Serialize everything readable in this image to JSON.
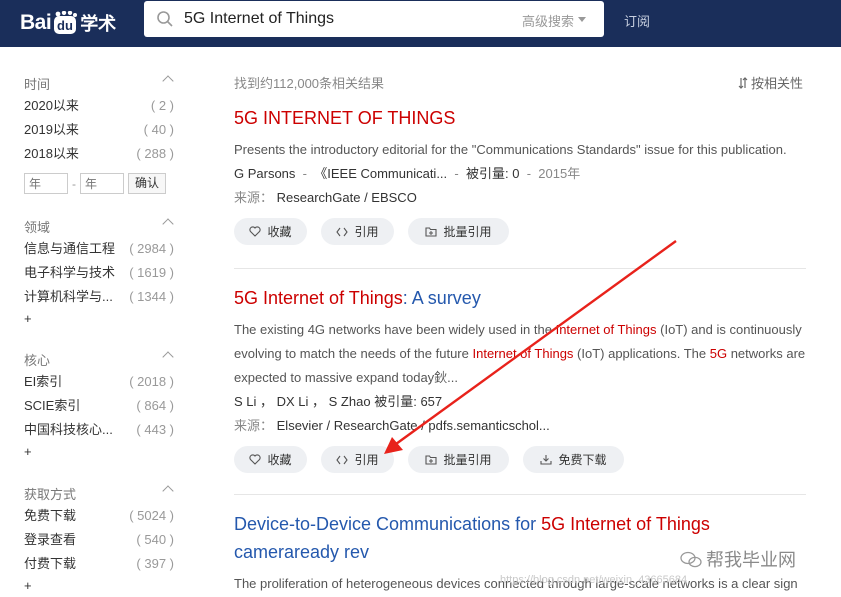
{
  "header": {
    "logo_text_1": "Bai",
    "logo_text_2": "学术",
    "search_value": "5G Internet of Things",
    "advanced_search": "高级搜索",
    "subscribe": "订阅"
  },
  "sidebar": {
    "time": {
      "title": "时间",
      "items": [
        {
          "label": "2020以来",
          "count": "( 2 )"
        },
        {
          "label": "2019以来",
          "count": "( 40 )"
        },
        {
          "label": "2018以来",
          "count": "( 288 )"
        }
      ],
      "year_from_placeholder": "年",
      "year_to_placeholder": "年",
      "confirm": "确认"
    },
    "field": {
      "title": "领域",
      "items": [
        {
          "label": "信息与通信工程",
          "count": "( 2984 )"
        },
        {
          "label": "电子科学与技术",
          "count": "( 1619 )"
        },
        {
          "label": "计算机科学与...",
          "count": "( 1344 )"
        }
      ],
      "more": "+"
    },
    "core": {
      "title": "核心",
      "items": [
        {
          "label": "EI索引",
          "count": "( 2018 )"
        },
        {
          "label": "SCIE索引",
          "count": "( 864 )"
        },
        {
          "label": "中国科技核心...",
          "count": "( 443 )"
        }
      ],
      "more": "+"
    },
    "access": {
      "title": "获取方式",
      "items": [
        {
          "label": "免费下载",
          "count": "( 5024 )"
        },
        {
          "label": "登录查看",
          "count": "( 540 )"
        },
        {
          "label": "付费下载",
          "count": "( 397 )"
        }
      ],
      "more": "+"
    }
  },
  "results_count": "找到约112,000条相关结果",
  "sort_label": "按相关性",
  "results": [
    {
      "title": "5G INTERNET OF THINGS",
      "abstract": "Presents the introductory editorial for the \"Communications Standards\" issue for this publication.",
      "authors": "G Parsons",
      "journal": "《IEEE Communicati...",
      "cited_label": "被引量:",
      "cited": "0",
      "year": "2015年",
      "source_label": "来源：",
      "sources": "ResearchGate  /  EBSCO",
      "actions": [
        "收藏",
        "引用",
        "批量引用"
      ]
    },
    {
      "title_hl": "5G Internet of Things",
      "title_rest": ": A survey",
      "abstract_1": "The existing 4G networks have been widely used in the ",
      "abstract_hl1": "Internet of Things",
      "abstract_2": " (IoT) and is continuously evolving to match the needs of the future ",
      "abstract_hl2": "Internet of Things",
      "abstract_3": " (IoT) applications. The ",
      "abstract_hl3": "5G",
      "abstract_4": " networks are expected to massive expand today鈥...",
      "authors": "S Li  ，  DX Li  ，  S Zhao",
      "cited_label": "被引量:",
      "cited": "657",
      "source_label": "来源：",
      "sources": "Elsevier  /  ResearchGate  /  pdfs.semanticschol...",
      "actions": [
        "收藏",
        "引用",
        "批量引用",
        "免费下载"
      ]
    },
    {
      "title_1": "Device-to-Device Communications for ",
      "title_hl": "5G Internet of Things",
      "title_2": "cameraready rev",
      "abstract": "The proliferation of heterogeneous devices connected through large-scale networks is a clear sign"
    }
  ],
  "watermark": "帮我毕业网",
  "watermark_url": "https://blog.csdn.net/weixin_43665684",
  "colors": {
    "header_bg": "#1a2e5a",
    "link": "#2458ad",
    "highlight": "#cc0000",
    "annotation_arrow": "#e8221b"
  }
}
